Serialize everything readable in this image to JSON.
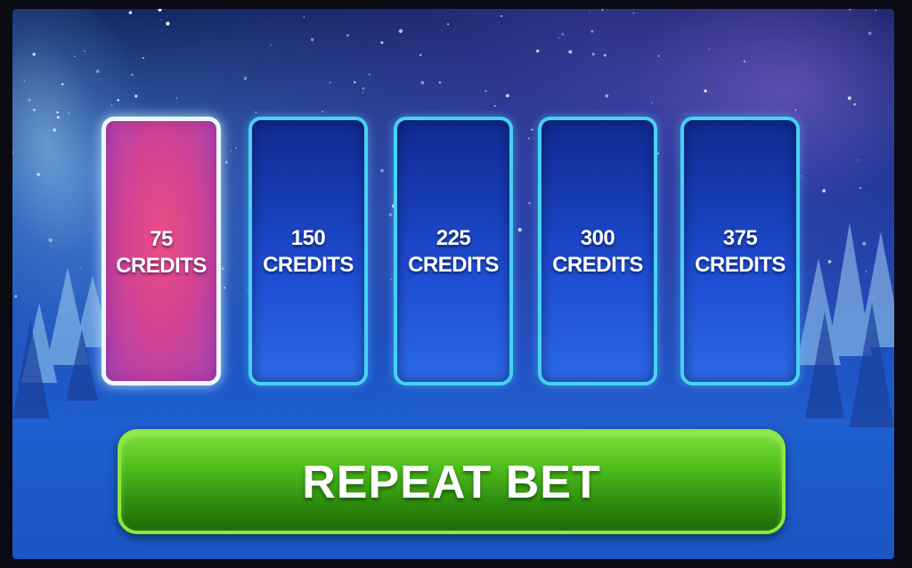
{
  "bet_options": [
    {
      "amount": "75",
      "unit": "CREDITS",
      "selected": true
    },
    {
      "amount": "150",
      "unit": "CREDITS",
      "selected": false
    },
    {
      "amount": "225",
      "unit": "CREDITS",
      "selected": false
    },
    {
      "amount": "300",
      "unit": "CREDITS",
      "selected": false
    },
    {
      "amount": "375",
      "unit": "CREDITS",
      "selected": false
    }
  ],
  "repeat_button": {
    "label": "REPEAT BET"
  },
  "colors": {
    "selected_tile": "#d44392",
    "tile": "#1d4bd0",
    "tile_border": "#46d2f4",
    "repeat_button": "#4fbf1d"
  }
}
